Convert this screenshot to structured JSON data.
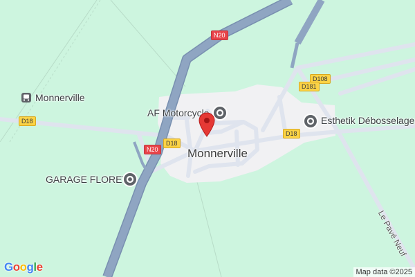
{
  "map": {
    "town_label": "Monnerville",
    "place_label": "Monnerville",
    "pois": [
      {
        "label": "AF Motorcycle"
      },
      {
        "label": "Esthetik Débosselages"
      },
      {
        "label": "GARAGE FLORET"
      }
    ],
    "shields": {
      "n20_top": "N20",
      "n20_bottom": "N20",
      "d18_left": "D18",
      "d18_center": "D18",
      "d18_right": "D18",
      "d108": "D108",
      "d181": "D181"
    },
    "road_name": "Le Pavé Neuf",
    "attribution": "Map data ©2025",
    "logo_letters": [
      "G",
      "o",
      "o",
      "g",
      "l",
      "e"
    ]
  },
  "colors": {
    "land": "#cdf5df",
    "urban": "#f1f1f3",
    "highway": "#8fa5c2",
    "highway_edge": "#7990b0",
    "road": "#dfe4ee",
    "pin": "#e53935",
    "logo": [
      "#4285f4",
      "#ea4335",
      "#fbbc05",
      "#4285f4",
      "#34a853",
      "#ea4335"
    ]
  }
}
